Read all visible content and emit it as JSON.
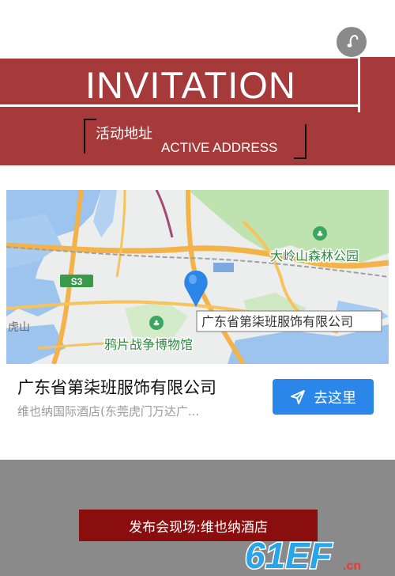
{
  "header": {
    "title": "INVITATION",
    "subtitle_cn": "活动地址",
    "subtitle_en": "ACTIVE ADDRESS"
  },
  "map": {
    "labels": {
      "park": "大岭山森林公园",
      "highway": "S3",
      "museum": "鸦片战争博物馆",
      "west_edge": "虎山",
      "location": "广东省第柒班服饰有限公司"
    }
  },
  "location_card": {
    "name": "广东省第柒班服饰有限公司",
    "address": "维也纳国际酒店(东莞虎门万达广...",
    "button_label": "去这里"
  },
  "footer": {
    "banner_text": "发布会现场:维也纳酒店"
  },
  "logo": {
    "text": "61EF",
    "suffix": ".cn"
  },
  "colors": {
    "header_band": "#a63a3a",
    "button_blue": "#2a86e8",
    "footer_gray": "#8a8a8a",
    "banner_red": "#8b0e0e"
  },
  "icons": [
    "music-note-icon",
    "location-pin-icon",
    "send-arrow-icon",
    "park-pin-icon"
  ]
}
